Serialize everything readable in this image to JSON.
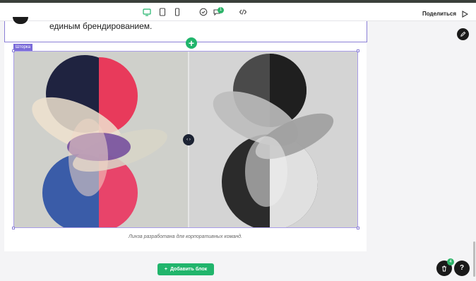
{
  "toolbar": {
    "comment_count": "1",
    "share_label": "Поделиться"
  },
  "previous_block": {
    "text": "единым брендированием."
  },
  "block": {
    "label": "Шторка",
    "caption": "Линза разработана для корпоративных команд."
  },
  "footer": {
    "add_block_label": "Добавить блок",
    "trash_count": "4",
    "help_label": "?"
  },
  "colors": {
    "accent": "#21b56c",
    "selection": "#8b7fd6",
    "dark_fab": "#1a1a1a"
  },
  "icons": [
    "desktop-icon",
    "tablet-icon",
    "mobile-icon",
    "check-icon",
    "comment-icon",
    "code-icon",
    "play-icon",
    "pencil-icon",
    "trash-icon",
    "plus-icon",
    "compare-arrows-icon"
  ]
}
